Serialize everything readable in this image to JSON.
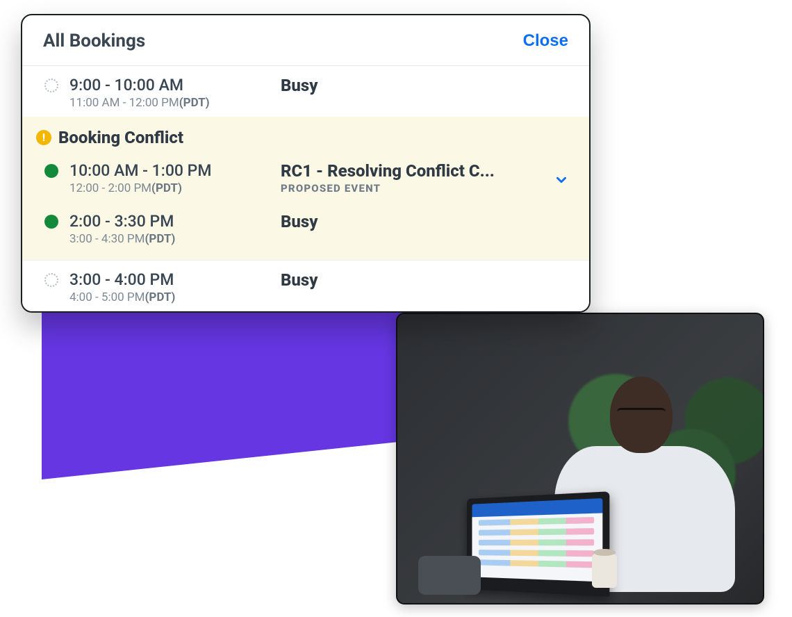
{
  "panel": {
    "title": "All Bookings",
    "close_label": "Close",
    "conflict_header": "Booking Conflict",
    "proposed_label": "PROPOSED EVENT",
    "tz_label": "(PDT)"
  },
  "bookings": [
    {
      "status": "dashed",
      "time_primary": "9:00 - 10:00 AM",
      "time_secondary": "11:00 AM - 12:00 PM",
      "title": "Busy",
      "conflict": false
    },
    {
      "status": "green",
      "time_primary": "10:00 AM - 1:00 PM",
      "time_secondary": "12:00 - 2:00 PM",
      "title": "RC1 - Resolving Conflict C...",
      "proposed": true,
      "conflict": true,
      "expandable": true
    },
    {
      "status": "green",
      "time_primary": "2:00 - 3:30 PM",
      "time_secondary": "3:00 - 4:30 PM",
      "title": "Busy",
      "conflict": true
    },
    {
      "status": "dashed",
      "time_primary": "3:00 - 4:00 PM",
      "time_secondary": "4:00 - 5:00 PM",
      "title": "Busy",
      "conflict": false
    }
  ],
  "colors": {
    "accent_blue": "#0c6ff0",
    "conflict_bg": "#fcf8e6",
    "warn_yellow": "#f2b705",
    "dot_green": "#128a3a",
    "purple": "#6536e2"
  }
}
